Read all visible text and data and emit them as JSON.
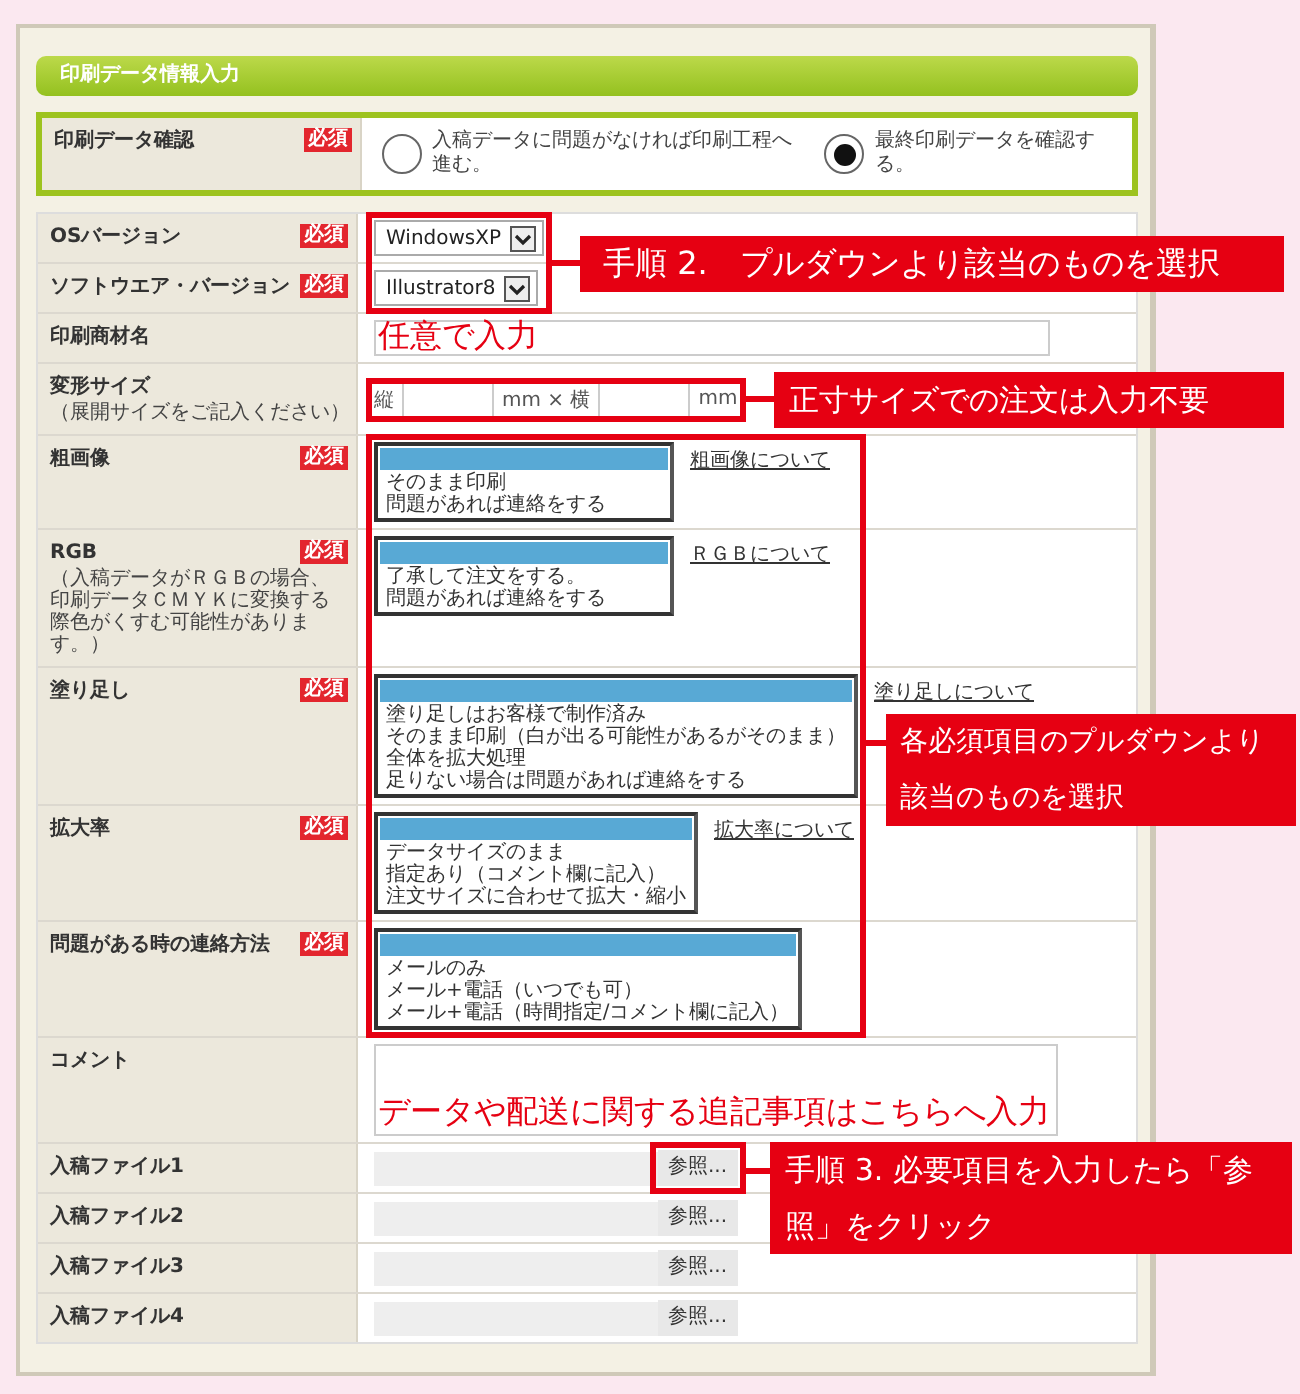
{
  "title": "印刷データ情報入力",
  "groups": [
    {
      "highlighted": true,
      "rows": [
        {
          "kind": "radio",
          "label": "印刷データ確認",
          "badge": "必須",
          "options": [
            {
              "label": "入稿データに問題がなければ印刷工程へ進む。",
              "selected": false
            },
            {
              "label": "最終印刷データを確認する。",
              "selected": true
            }
          ]
        }
      ]
    },
    {
      "highlighted": false,
      "rows": [
        {
          "kind": "select",
          "label": "OSバージョン",
          "badge": "必須",
          "value": "WindowsXP"
        },
        {
          "kind": "select",
          "label": "ソフトウエア・バージョン",
          "badge": "必須",
          "value": "Illustrator8"
        },
        {
          "kind": "text",
          "label": "印刷商材名"
        },
        {
          "kind": "size",
          "label": "変形サイズ",
          "note": "（展開サイズをご記入ください）",
          "prefix": "縦",
          "middle": "mm × 横",
          "unit": "mm"
        },
        {
          "kind": "listbox",
          "label": "粗画像",
          "badge": "必須",
          "blank_selected": true,
          "options": [
            {
              "label": "そのまま印刷",
              "selected": false
            },
            {
              "label": "問題があれば連絡をする",
              "selected": false
            }
          ],
          "link": "粗画像について"
        },
        {
          "kind": "listbox",
          "label": "RGB",
          "note": "（入稿データがＲＧＢの場合、印刷データＣＭＹＫに変換する際色がくすむ可能性があります。）",
          "badge": "必須",
          "blank_selected": true,
          "options": [
            {
              "label": "了承して注文をする。",
              "selected": false
            },
            {
              "label": "問題があれば連絡をする",
              "selected": false
            }
          ],
          "link": "ＲＧＢについて"
        },
        {
          "kind": "listbox",
          "label": "塗り足し",
          "badge": "必須",
          "blank_selected": true,
          "options": [
            {
              "label": "塗り足しはお客様で制作済み",
              "selected": false
            },
            {
              "label": "そのまま印刷（白が出る可能性があるがそのまま）",
              "selected": false
            },
            {
              "label": "全体を拡大処理",
              "selected": false
            },
            {
              "label": "足りない場合は問題があれば連絡をする",
              "selected": false
            }
          ],
          "link": "塗り足しについて"
        },
        {
          "kind": "listbox",
          "label": "拡大率",
          "badge": "必須",
          "blank_selected": true,
          "options": [
            {
              "label": "データサイズのまま",
              "selected": false
            },
            {
              "label": "指定あり（コメント欄に記入）",
              "selected": false
            },
            {
              "label": "注文サイズに合わせて拡大・縮小",
              "selected": false
            }
          ],
          "link": "拡大率について"
        },
        {
          "kind": "listbox",
          "label": "問題がある時の連絡方法",
          "badge": "必須",
          "blank_selected": true,
          "options": [
            {
              "label": "メールのみ",
              "selected": false
            },
            {
              "label": "メール+電話（いつでも可）",
              "selected": false
            },
            {
              "label": "メール+電話（時間指定/コメント欄に記入）",
              "selected": false
            }
          ]
        },
        {
          "kind": "textarea",
          "label": "コメント"
        },
        {
          "kind": "file",
          "label": "入稿ファイル1",
          "button": "参照..."
        },
        {
          "kind": "file",
          "label": "入稿ファイル2",
          "button": "参照..."
        },
        {
          "kind": "file",
          "label": "入稿ファイル3",
          "button": "参照..."
        },
        {
          "kind": "file",
          "label": "入稿ファイル4",
          "button": "参照..."
        }
      ]
    }
  ],
  "annotations": [
    {
      "kind": "callout",
      "text": "手順 2.　プルダウンより該当のものを選択"
    },
    {
      "kind": "note",
      "text": "任意で入力"
    },
    {
      "kind": "callout",
      "text": "正寸サイズでの注文は入力不要"
    },
    {
      "kind": "callout",
      "text": "各必須項目のプルダウンより該当のものを選択"
    },
    {
      "kind": "note",
      "text": "データや配送に関する追記事項はこちらへ入力"
    },
    {
      "kind": "callout",
      "text": "手順 3. 必要項目を入力したら「参照」をクリック"
    }
  ]
}
